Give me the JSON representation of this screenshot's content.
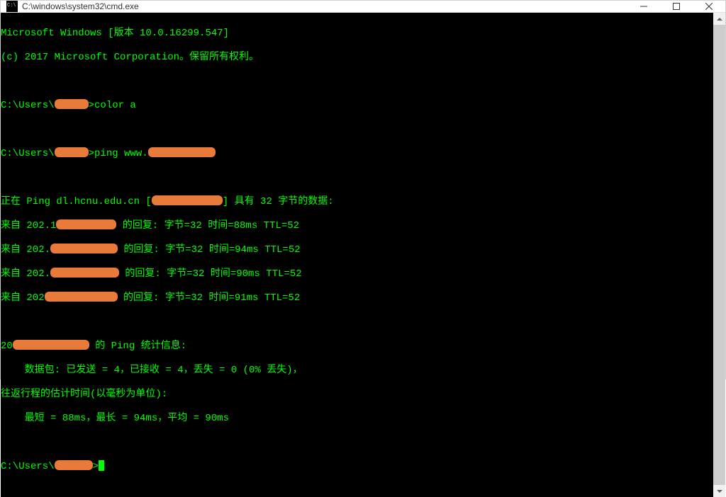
{
  "window": {
    "title": "C:\\windows\\system32\\cmd.exe"
  },
  "console": {
    "line1": "Microsoft Windows [版本 10.0.16299.547]",
    "line2": "(c) 2017 Microsoft Corporation。保留所有权利。",
    "prompt1_pre": "C:\\Users\\",
    "prompt1_post": ">color a",
    "prompt2_pre": "C:\\Users\\",
    "prompt2_post": ">ping www.",
    "pinging_pre": "正在 Ping dl.hcnu.edu.cn [",
    "pinging_post": "] 具有 32 字节的数据:",
    "reply1_pre": "来自 202.1",
    "reply1_post": " 的回复: 字节=32 时间=88ms TTL=52",
    "reply2_pre": "来自 202.",
    "reply2_post": " 的回复: 字节=32 时间=94ms TTL=52",
    "reply3_pre": "来自 202.",
    "reply3_post": " 的回复: 字节=32 时间=90ms TTL=52",
    "reply4_pre": "来自 202",
    "reply4_post": " 的回复: 字节=32 时间=91ms TTL=52",
    "stats_header_pre": "20",
    "stats_header_post": " 的 Ping 统计信息:",
    "stats_packets": "    数据包: 已发送 = 4，已接收 = 4，丢失 = 0 (0% 丢失)，",
    "stats_rtt_header": "往返行程的估计时间(以毫秒为单位):",
    "stats_rtt": "    最短 = 88ms，最长 = 94ms，平均 = 90ms",
    "prompt3_pre": "C:\\Users\\",
    "prompt3_post": ">"
  }
}
